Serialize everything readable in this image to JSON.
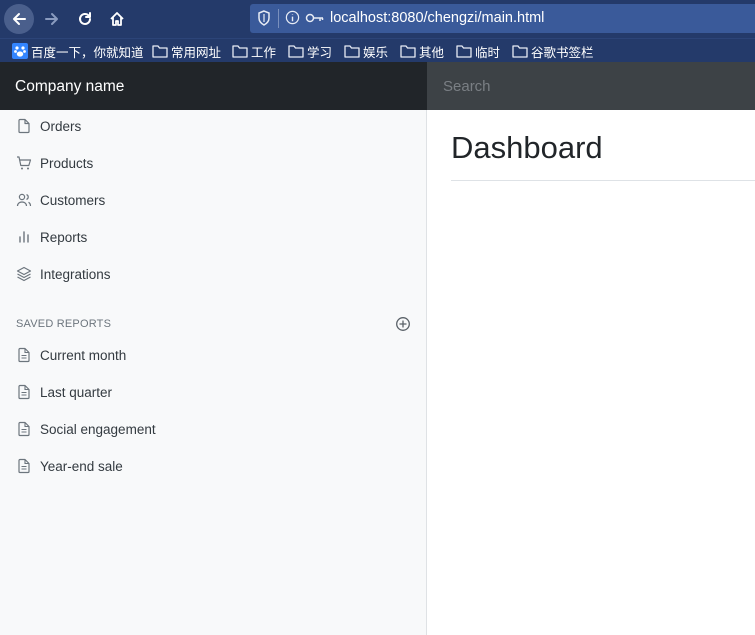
{
  "browser": {
    "url": "localhost:8080/chengzi/main.html",
    "bookmarks": [
      {
        "label": "百度一下，你就知道",
        "icon": "baidu-paw-icon"
      },
      {
        "label": "常用网址",
        "icon": "folder-icon"
      },
      {
        "label": "工作",
        "icon": "folder-icon"
      },
      {
        "label": "学习",
        "icon": "folder-icon"
      },
      {
        "label": "娱乐",
        "icon": "folder-icon"
      },
      {
        "label": "其他",
        "icon": "folder-icon"
      },
      {
        "label": "临时",
        "icon": "folder-icon"
      },
      {
        "label": "谷歌书签栏",
        "icon": "folder-icon"
      }
    ]
  },
  "navbar": {
    "brand": "Company name",
    "search_placeholder": "Search"
  },
  "sidebar": {
    "items": [
      {
        "label": "Orders",
        "icon": "file-icon"
      },
      {
        "label": "Products",
        "icon": "shopping-cart-icon"
      },
      {
        "label": "Customers",
        "icon": "users-icon"
      },
      {
        "label": "Reports",
        "icon": "bar-chart-icon"
      },
      {
        "label": "Integrations",
        "icon": "layers-icon"
      }
    ],
    "saved_heading": "SAVED REPORTS",
    "saved_reports": [
      {
        "label": "Current month",
        "icon": "file-text-icon"
      },
      {
        "label": "Last quarter",
        "icon": "file-text-icon"
      },
      {
        "label": "Social engagement",
        "icon": "file-text-icon"
      },
      {
        "label": "Year-end sale",
        "icon": "file-text-icon"
      }
    ]
  },
  "main": {
    "title": "Dashboard"
  },
  "colors": {
    "browser_chrome": "#243a6a",
    "navbar": "#343a40",
    "brand_bg": "#212529",
    "sidebar_bg": "#f8f9fa"
  }
}
